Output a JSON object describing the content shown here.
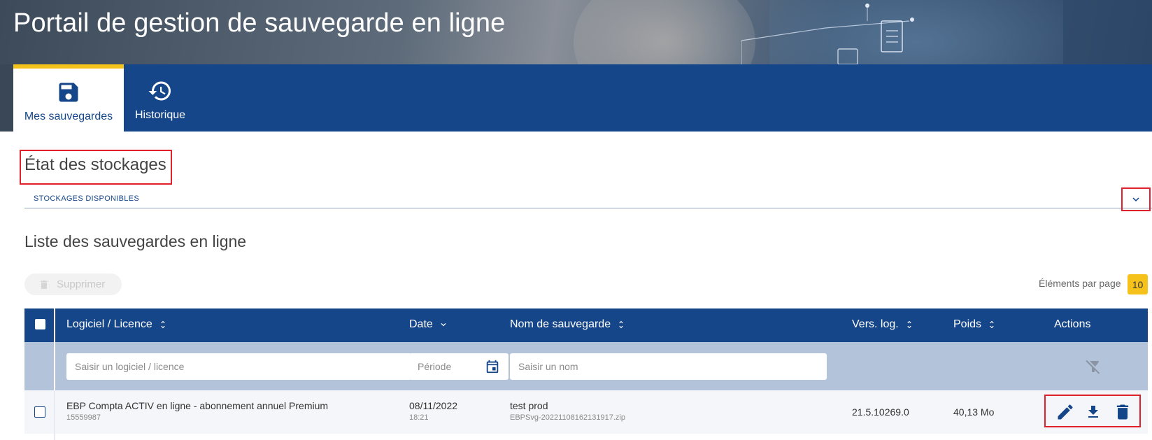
{
  "window": {
    "title": "Portail de gestion de sauvegarde en ligne"
  },
  "tabs": [
    {
      "label": "Mes sauvegardes",
      "icon": "save-icon",
      "active": true
    },
    {
      "label": "Historique",
      "icon": "history-icon",
      "active": false
    }
  ],
  "storage": {
    "title": "État des stockages",
    "available_label": "STOCKAGES DISPONIBLES"
  },
  "list": {
    "title": "Liste des sauvegardes en ligne",
    "delete_label": "Supprimer",
    "per_page_label": "Éléments par page",
    "per_page_value": "10"
  },
  "table": {
    "headers": {
      "software": "Logiciel / Licence",
      "date": "Date",
      "name": "Nom de sauvegarde",
      "version": "Vers. log.",
      "size": "Poids",
      "actions": "Actions"
    },
    "filters": {
      "software_placeholder": "Saisir un logiciel / licence",
      "period_placeholder": "Période",
      "name_placeholder": "Saisir un nom"
    },
    "rows": [
      {
        "software": "EBP Compta ACTIV en ligne - abonnement annuel Premium",
        "license": "15559987",
        "date": "08/11/2022",
        "time": "18:21",
        "name": "test prod",
        "file": "EBPSvg-20221108162131917.zip",
        "version": "21.5.10269.0",
        "size": "40,13 Mo"
      }
    ]
  },
  "colors": {
    "primary": "#15468a",
    "accent": "#f5c21b",
    "highlight": "#e0212b",
    "filter_bg": "#b3c3d9"
  }
}
